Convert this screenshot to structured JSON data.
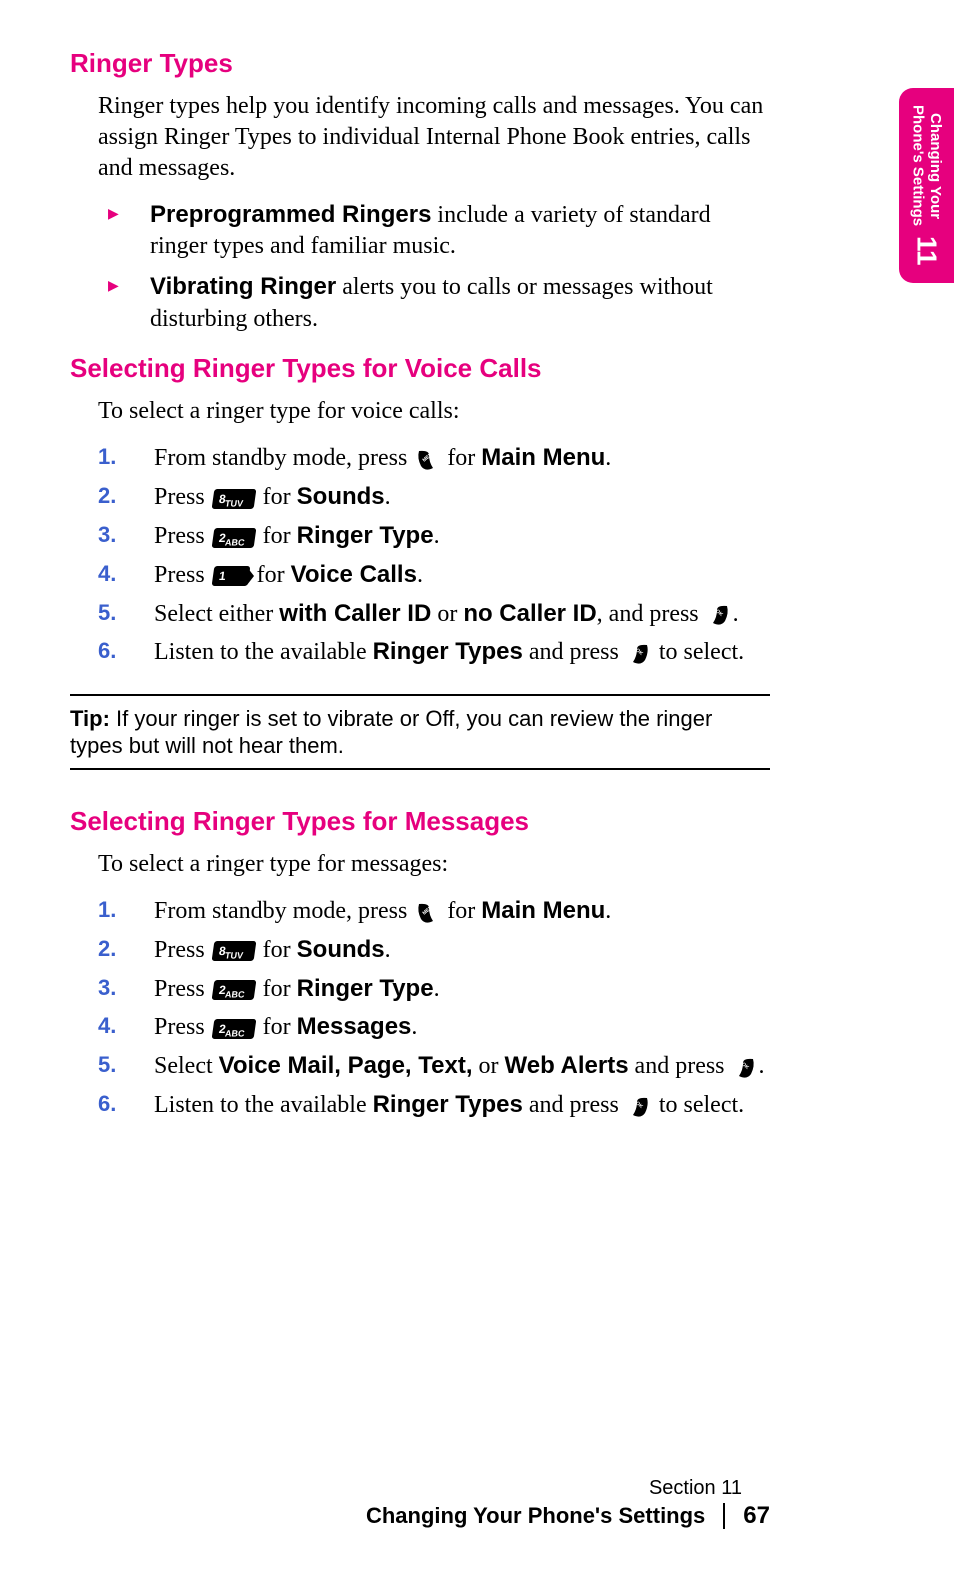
{
  "tab": {
    "line1": "Changing Your",
    "line2": "Phone's Settings",
    "number": "11"
  },
  "h1": "Ringer Types",
  "intro": "Ringer types help you identify incoming calls and messages. You can assign Ringer Types to individual Internal Phone Book entries, calls and messages.",
  "bullets": [
    {
      "bold": "Preprogrammed Ringers",
      "rest": " include a variety of standard ringer types and familiar music."
    },
    {
      "bold": "Vibrating Ringer",
      "rest": " alerts you to calls or messages without disturbing others."
    }
  ],
  "h2": "Selecting Ringer Types for Voice Calls",
  "intro2": "To select a ringer type for voice calls:",
  "keys": {
    "k8": {
      "num": "8",
      "sub": "TUV"
    },
    "k2": {
      "num": "2",
      "sub": "ABC"
    },
    "k1": {
      "num": "1",
      "sub": ""
    }
  },
  "steps1": {
    "s1a": "From standby mode, press ",
    "s1b": " for ",
    "s1c": "Main Menu",
    "s1d": ".",
    "s2a": "Press ",
    "s2b": " for ",
    "s2c": "Sounds",
    "s2d": ".",
    "s3a": "Press ",
    "s3b": " for ",
    "s3c": "Ringer Type",
    "s3d": ".",
    "s4a": "Press ",
    "s4b": " for ",
    "s4c": "Voice Calls",
    "s4d": ".",
    "s5a": "Select either ",
    "s5b": "with Caller ID",
    "s5c": " or ",
    "s5d": "no Caller ID",
    "s5e": ", and press ",
    "s5f": ".",
    "s6a": "Listen to the available ",
    "s6b": "Ringer Types",
    "s6c": " and press ",
    "s6d": " to select."
  },
  "tip": {
    "label": "Tip:",
    "text": " If your ringer is set to vibrate or Off, you can review the ringer types but will not hear them."
  },
  "h3": "Selecting Ringer Types for Messages",
  "intro3": "To select a ringer type for messages:",
  "steps2": {
    "s1a": "From standby mode, press ",
    "s1b": " for ",
    "s1c": "Main Menu",
    "s1d": ".",
    "s2a": "Press ",
    "s2b": " for ",
    "s2c": "Sounds",
    "s2d": ".",
    "s3a": "Press ",
    "s3b": " for ",
    "s3c": "Ringer Type",
    "s3d": ".",
    "s4a": "Press ",
    "s4b": " for ",
    "s4c": "Messages",
    "s4d": ".",
    "s5a": "Select ",
    "s5b": "Voice Mail, Page, Text,",
    "s5c": " or ",
    "s5d": "Web Alerts",
    "s5e": " and press ",
    "s5f": ".",
    "s6a": "Listen to the available ",
    "s6b": "Ringer Types",
    "s6c": " and press ",
    "s6d": " to select."
  },
  "footer": {
    "section": "Section 11",
    "title": "Changing Your Phone's Settings",
    "page": "67"
  }
}
